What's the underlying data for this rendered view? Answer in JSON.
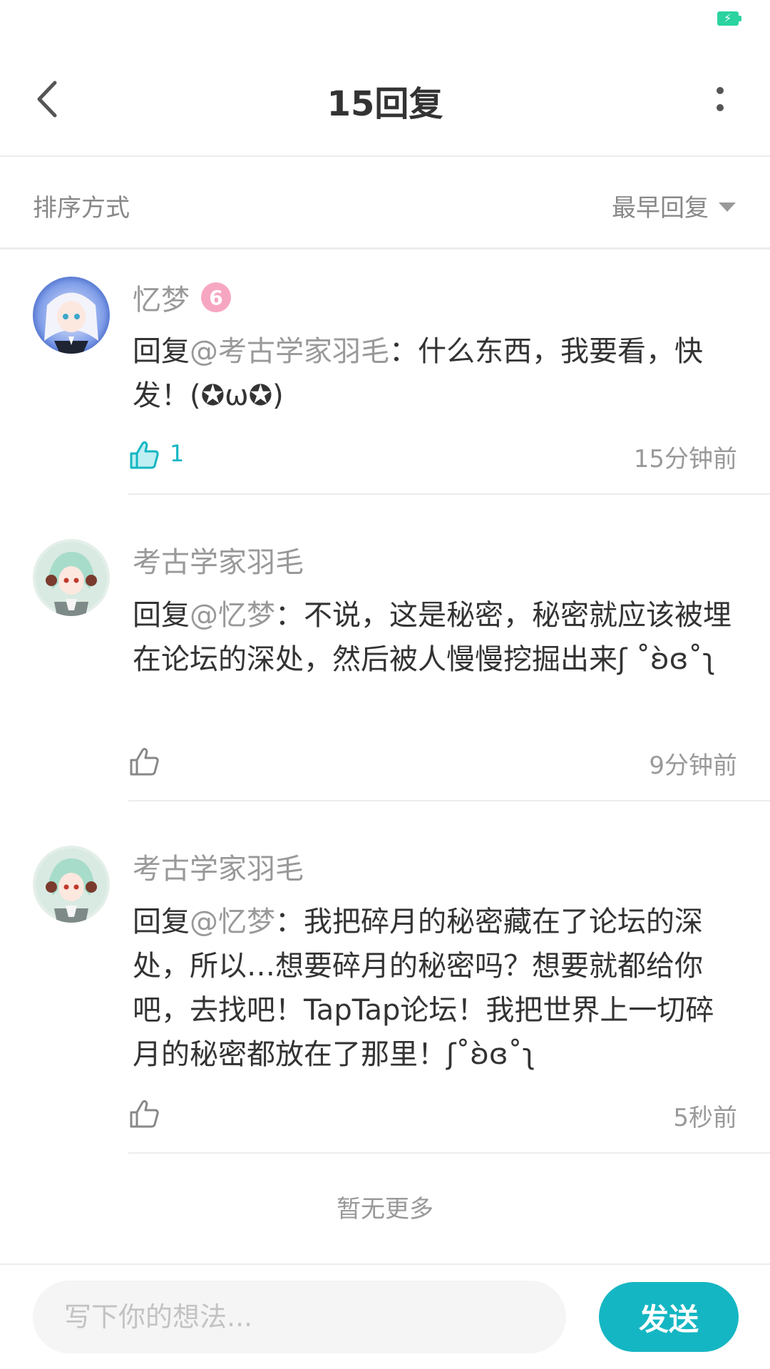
{
  "status_bar": {
    "battery_icon": "battery-charging-icon",
    "battery_color": "#2bd3a0",
    "bolt": "⚡"
  },
  "header": {
    "title": "15回复",
    "back_icon": "chevron-left-icon",
    "more_icon": "more-vertical-icon"
  },
  "sort": {
    "label": "排序方式",
    "selected": "最早回复",
    "caret_icon": "caret-down-icon"
  },
  "comments": [
    {
      "username": "忆梦",
      "level": "6",
      "reply_prefix": "回复",
      "mention": "@考古学家羽毛",
      "text": "：什么东西，我要看，快发！(✪ω✪)",
      "likes": "1",
      "liked": true,
      "time": "15分钟前"
    },
    {
      "username": "考古学家羽毛",
      "reply_prefix": "回复",
      "mention": "@忆梦",
      "text": "：不说，这是秘密，秘密就应该被埋在论坛的深处，然后被人慢慢挖掘出来ʃ ˚ʚ̀ɞ˚ʅ",
      "likes": "",
      "liked": false,
      "time": "9分钟前"
    },
    {
      "username": "考古学家羽毛",
      "reply_prefix": "回复",
      "mention": "@忆梦",
      "text": "：我把碎月的秘密藏在了论坛的深处，所以…想要碎月的秘密吗？想要就都给你吧，去找吧！TapTap论坛！我把世界上一切碎月的秘密都放在了那里！ʃ˚ʚ̀ɞ˚ʅ",
      "likes": "",
      "liked": false,
      "time": "5秒前"
    }
  ],
  "list_end": "暂无更多",
  "footer": {
    "placeholder": "写下你的想法...",
    "send_label": "发送"
  },
  "colors": {
    "accent": "#15b6c3",
    "muted_text": "#999999",
    "level_badge": "#f7a6c1"
  }
}
